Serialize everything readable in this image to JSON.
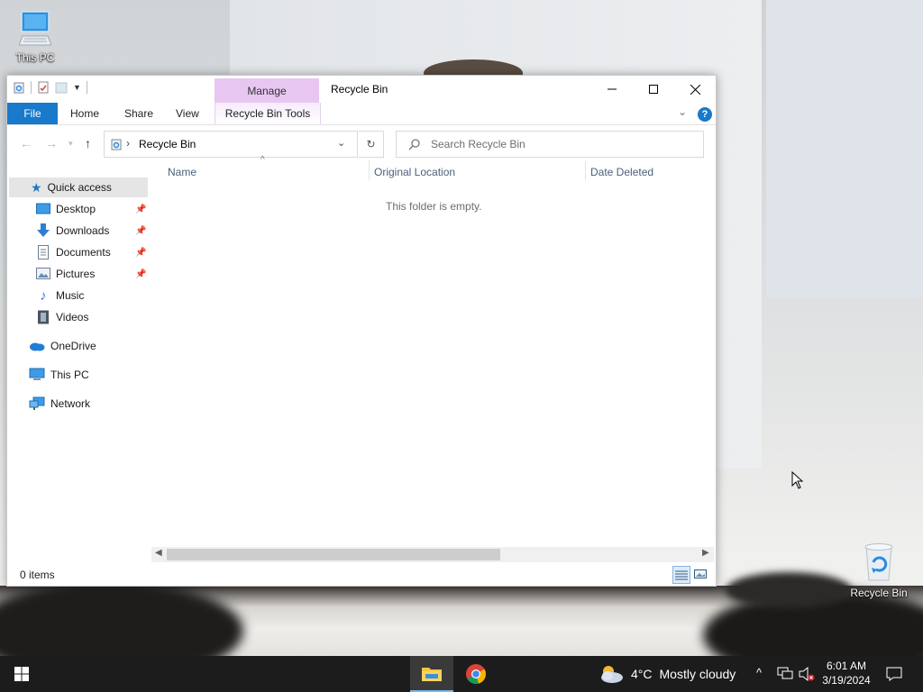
{
  "desktop": {
    "icons": [
      {
        "label": "This PC",
        "icon": "computer-icon"
      },
      {
        "label": "Recycle Bin",
        "icon": "recycle-bin-icon"
      }
    ]
  },
  "window": {
    "title": "Recycle Bin",
    "contextual_tab_group": "Manage",
    "ribbon_tabs": [
      "File",
      "Home",
      "Share",
      "View",
      "Recycle Bin Tools"
    ],
    "accent_color": "#1979ca",
    "contextual_color": "#e8c6f2",
    "address": {
      "crumb": "Recycle Bin"
    },
    "search": {
      "placeholder": "Search Recycle Bin"
    },
    "nav": {
      "quick_access": "Quick access",
      "pinned": [
        "Desktop",
        "Downloads",
        "Documents",
        "Pictures"
      ],
      "other": [
        "Music",
        "Videos"
      ],
      "onedrive": "OneDrive",
      "this_pc": "This PC",
      "network": "Network"
    },
    "columns": [
      "Name",
      "Original Location",
      "Date Deleted"
    ],
    "empty_text": "This folder is empty.",
    "status": "0 items"
  },
  "taskbar": {
    "weather": {
      "temp": "4°C",
      "condition": "Mostly cloudy"
    },
    "time": "6:01 AM",
    "date": "3/19/2024"
  }
}
